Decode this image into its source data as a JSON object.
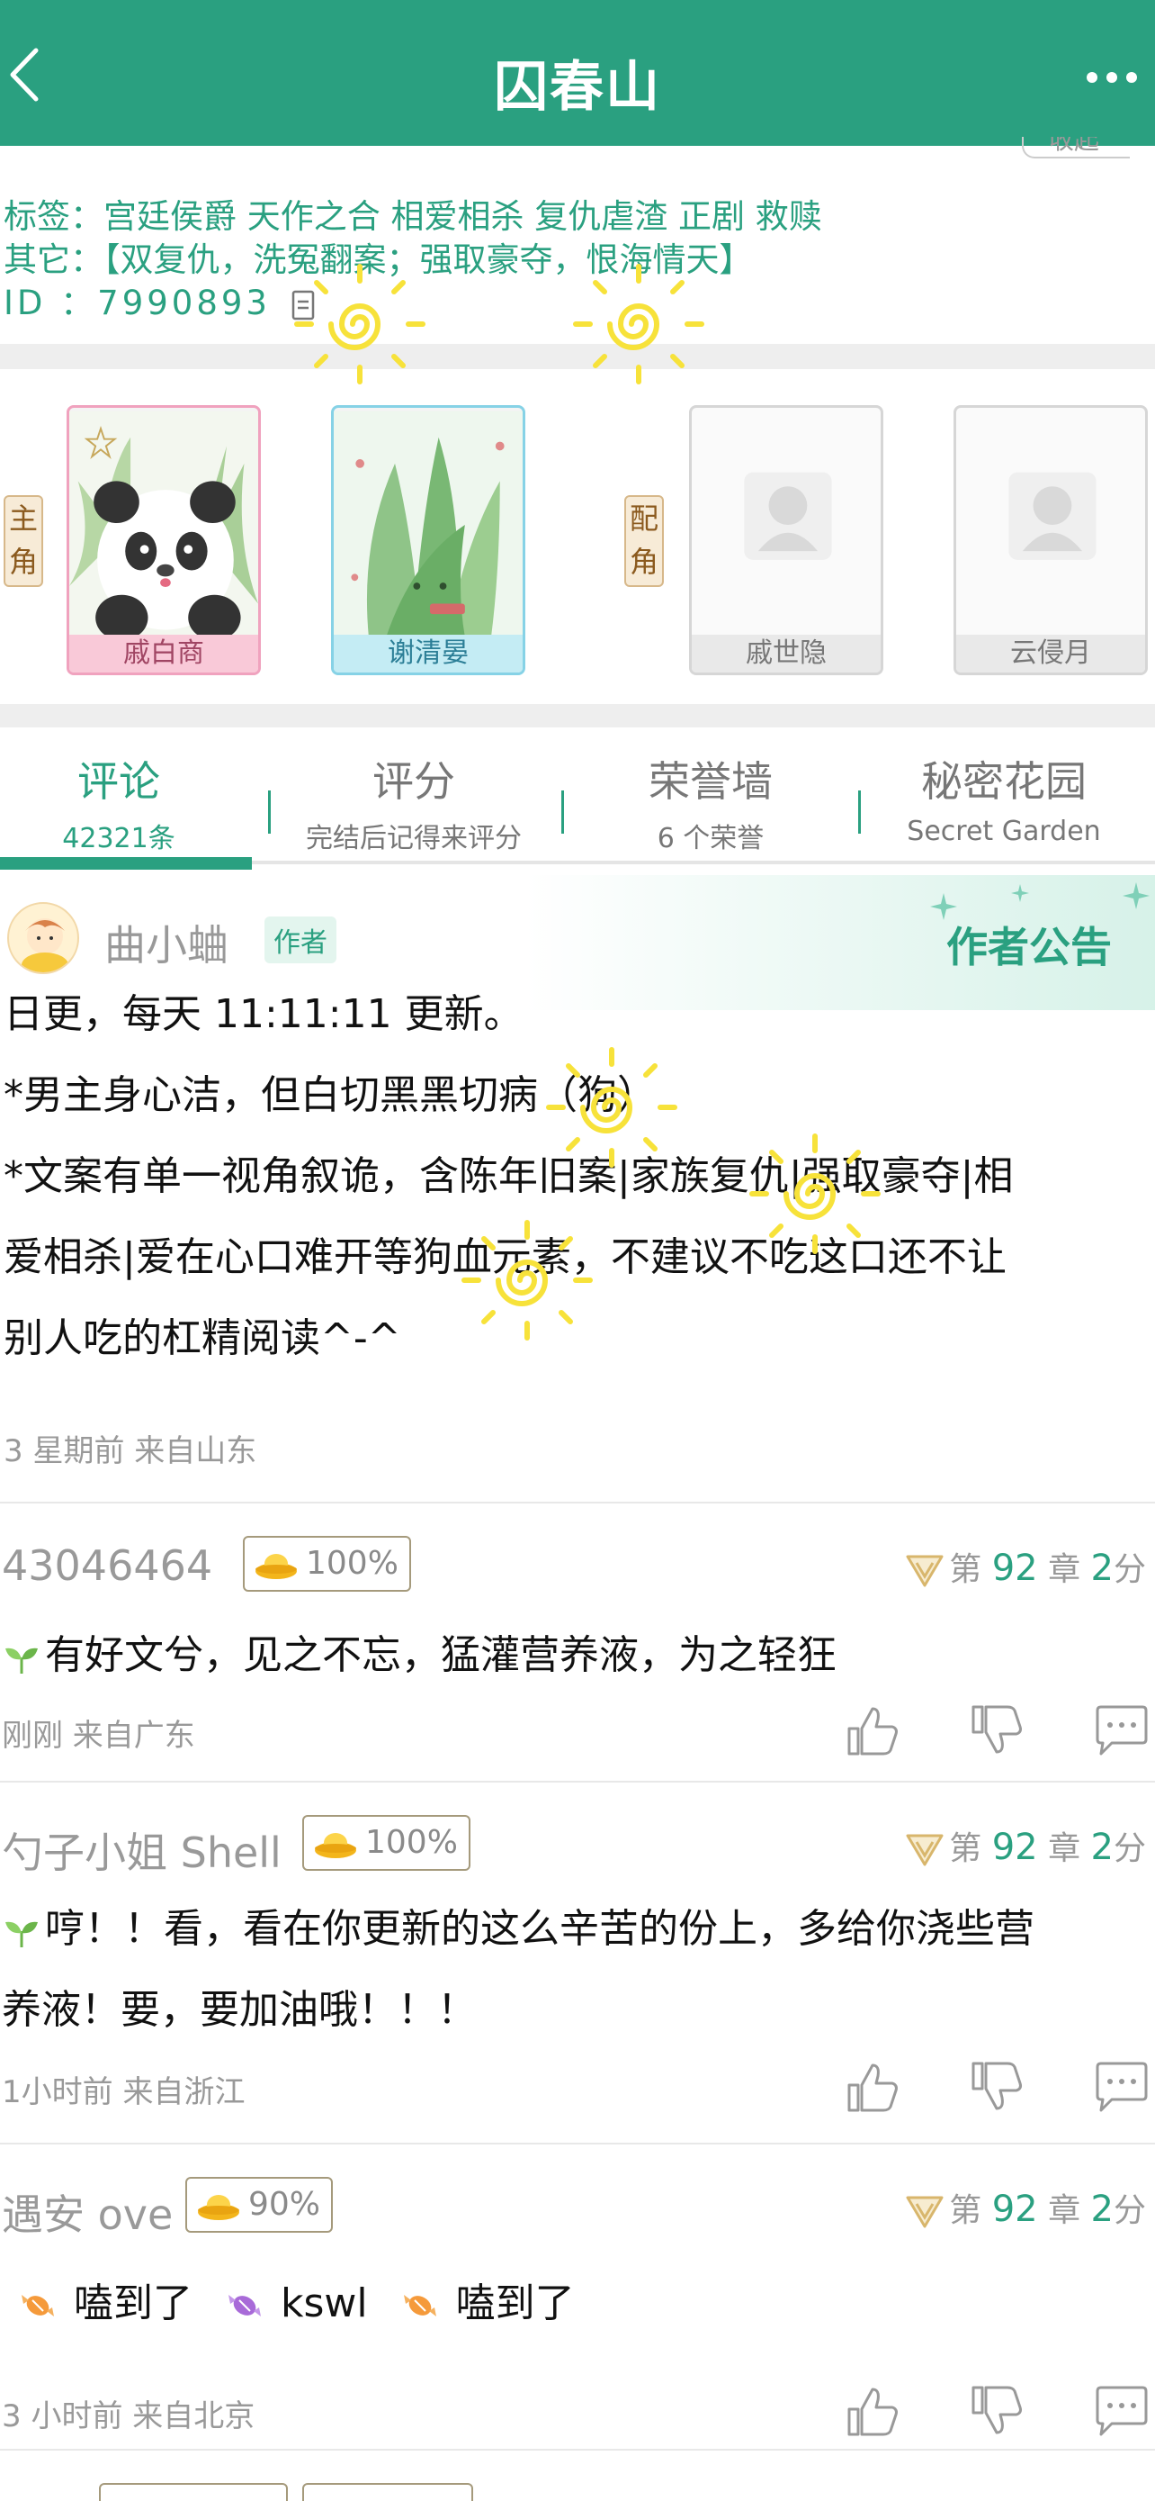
{
  "header": {
    "title": "囚春山"
  },
  "info": {
    "cut_text": "收起",
    "tags_line": "标签：宫廷侯爵  天作之合  相爱相杀  复仇虐渣  正剧  救赎",
    "other_line": "其它：【双复仇，洗冤翻案；强取豪夺，恨海情天】",
    "id_line": "ID  ：7990893"
  },
  "roles": {
    "main_tag": [
      "主",
      "角"
    ],
    "support_tag": [
      "配",
      "角"
    ],
    "cards": [
      {
        "name": "戚白商",
        "style": "pink",
        "art": "panda"
      },
      {
        "name": "谢清晏",
        "style": "blue",
        "art": "leaves"
      },
      {
        "name": "戚世隐",
        "style": "gray",
        "art": "placeholder"
      },
      {
        "name": "云侵月",
        "style": "gray",
        "art": "placeholder"
      }
    ]
  },
  "tabs": [
    {
      "title": "评论",
      "sub": "42321条",
      "active": true
    },
    {
      "title": "评分",
      "sub": "完结后记得来评分",
      "active": false
    },
    {
      "title": "荣誉墙",
      "sub": "6 个荣誉",
      "active": false
    },
    {
      "title": "秘密花园",
      "sub": "Secret Garden",
      "active": false
    }
  ],
  "notice": {
    "author": "曲小蛐",
    "badge": "作者",
    "title": "作者公告",
    "lines": [
      "日更，每天 11:11:11 更新。",
      "*男主身心洁，但白切黑黑切病（狗）",
      "*文案有单一视角叙诡，含陈年旧案|家族复仇|强取豪夺|相",
      "爱相杀|爱在心口难开等狗血元素，不建议不吃这口还不让",
      "别人吃的杠精阅读^-^"
    ],
    "meta": "3 星期前   来自山东"
  },
  "comments": [
    {
      "user": "43046464",
      "score": "100%",
      "chapter_prefix": "第",
      "chapter_num": "92",
      "chapter_mid": "章",
      "chapter_score": "2",
      "chapter_suffix": "分",
      "lines": [
        "有好文兮，见之不忘，猛灌营养液，为之轻狂"
      ],
      "meta": "刚刚   来自广东"
    },
    {
      "user": "勺子小姐 Shell",
      "score": "100%",
      "chapter_prefix": "第",
      "chapter_num": "92",
      "chapter_mid": "章",
      "chapter_score": "2",
      "chapter_suffix": "分",
      "lines": [
        "哼！！看，看在你更新的这么辛苦的份上，多给你浇些营",
        "养液！要，要加油哦！！！"
      ],
      "meta": "1小时前   来自浙江"
    },
    {
      "user": "遇安 ove",
      "score": "90%",
      "chapter_prefix": "第",
      "chapter_num": "92",
      "chapter_mid": "章",
      "chapter_score": "2",
      "chapter_suffix": "分",
      "segments": [
        "嗑到了",
        "kswl",
        "嗑到了"
      ],
      "meta": "3 小时前   来自北京"
    }
  ],
  "colors": {
    "brand": "#2aa080",
    "badge_bg": "#e3f5ee",
    "sun": "#f7e23a"
  }
}
